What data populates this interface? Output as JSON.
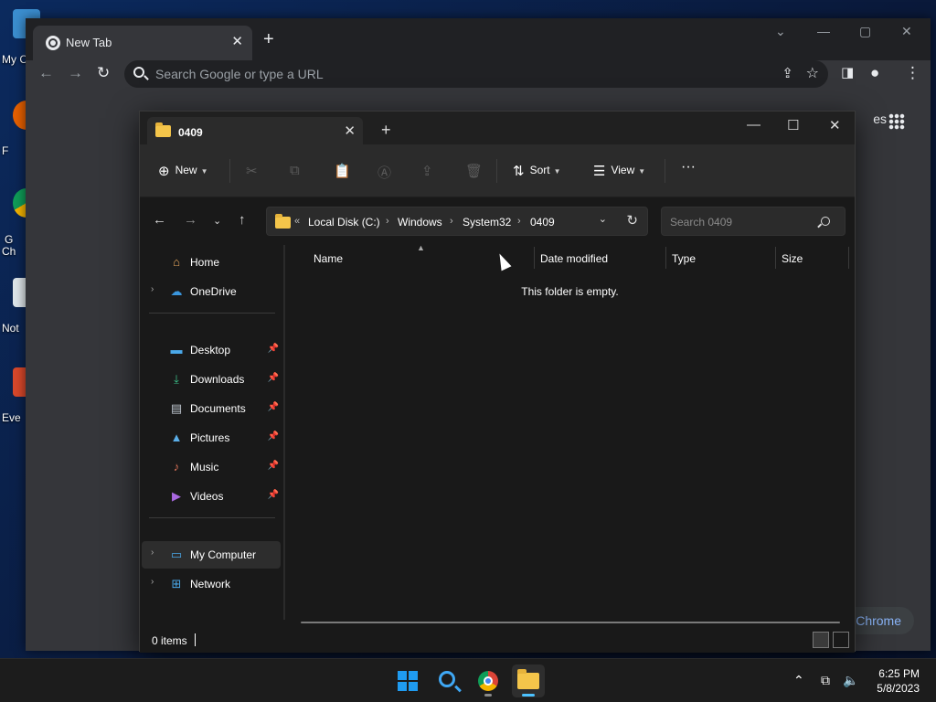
{
  "desktop": {
    "icons": [
      {
        "label": "My C"
      },
      {
        "label": "F"
      },
      {
        "label": "G\nCh"
      },
      {
        "label": "Not"
      },
      {
        "label": "Eve"
      }
    ]
  },
  "chrome": {
    "tab_title": "New Tab",
    "omnibox_placeholder": "Search Google or type a URL",
    "ntp_link": "es",
    "customize_label": "Chrome"
  },
  "explorer": {
    "tab_title": "0409",
    "commands": {
      "new": "New",
      "sort": "Sort",
      "view": "View"
    },
    "breadcrumb": [
      "Local Disk (C:)",
      "Windows",
      "System32",
      "0409"
    ],
    "search_placeholder": "Search 0409",
    "sidebar": {
      "home": "Home",
      "onedrive": "OneDrive",
      "quick": [
        {
          "label": "Desktop"
        },
        {
          "label": "Downloads"
        },
        {
          "label": "Documents"
        },
        {
          "label": "Pictures"
        },
        {
          "label": "Music"
        },
        {
          "label": "Videos"
        }
      ],
      "my_computer": "My Computer",
      "network": "Network"
    },
    "columns": {
      "name": "Name",
      "date": "Date modified",
      "type": "Type",
      "size": "Size"
    },
    "empty_message": "This folder is empty.",
    "status_count": "0 items"
  },
  "taskbar": {
    "time": "6:25 PM",
    "date": "5/8/2023"
  },
  "colors": {
    "accent": "#4cc2ff",
    "folder": "#f4c54a"
  }
}
